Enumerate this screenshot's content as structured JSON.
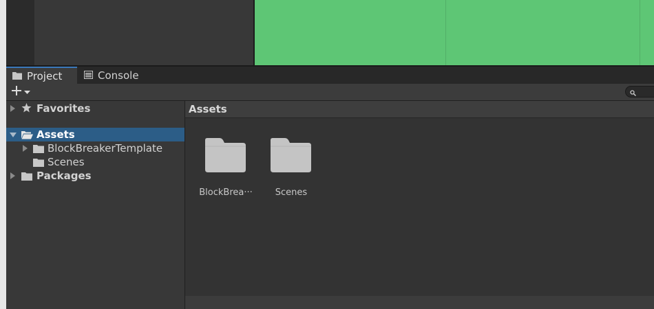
{
  "window": {
    "tabs": [
      {
        "label": "Project",
        "icon": "folder-icon",
        "active": true
      },
      {
        "label": "Console",
        "icon": "console-icon",
        "active": false
      }
    ]
  },
  "toolbar": {
    "create_icon": "plus-icon",
    "create_dropdown_icon": "chevron-down-icon",
    "search_icon": "search-icon"
  },
  "tree": {
    "favorites": {
      "label": "Favorites",
      "icon": "star-icon"
    },
    "assets": {
      "label": "Assets",
      "icon": "folder-open-icon",
      "selected": true
    },
    "assets_children": [
      {
        "label": "BlockBreakerTemplate",
        "icon": "folder-icon"
      },
      {
        "label": "Scenes",
        "icon": "folder-icon"
      }
    ],
    "packages": {
      "label": "Packages",
      "icon": "folder-icon"
    }
  },
  "assets_panel": {
    "breadcrumb": "Assets",
    "items": [
      {
        "label": "BlockBrea···",
        "icon": "folder-icon"
      },
      {
        "label": "Scenes",
        "icon": "folder-icon"
      }
    ]
  },
  "colors": {
    "accent": "#3a79bb",
    "selection": "#2c5d87",
    "game_view": "#5ec675",
    "folder": "#c4c4c4"
  }
}
